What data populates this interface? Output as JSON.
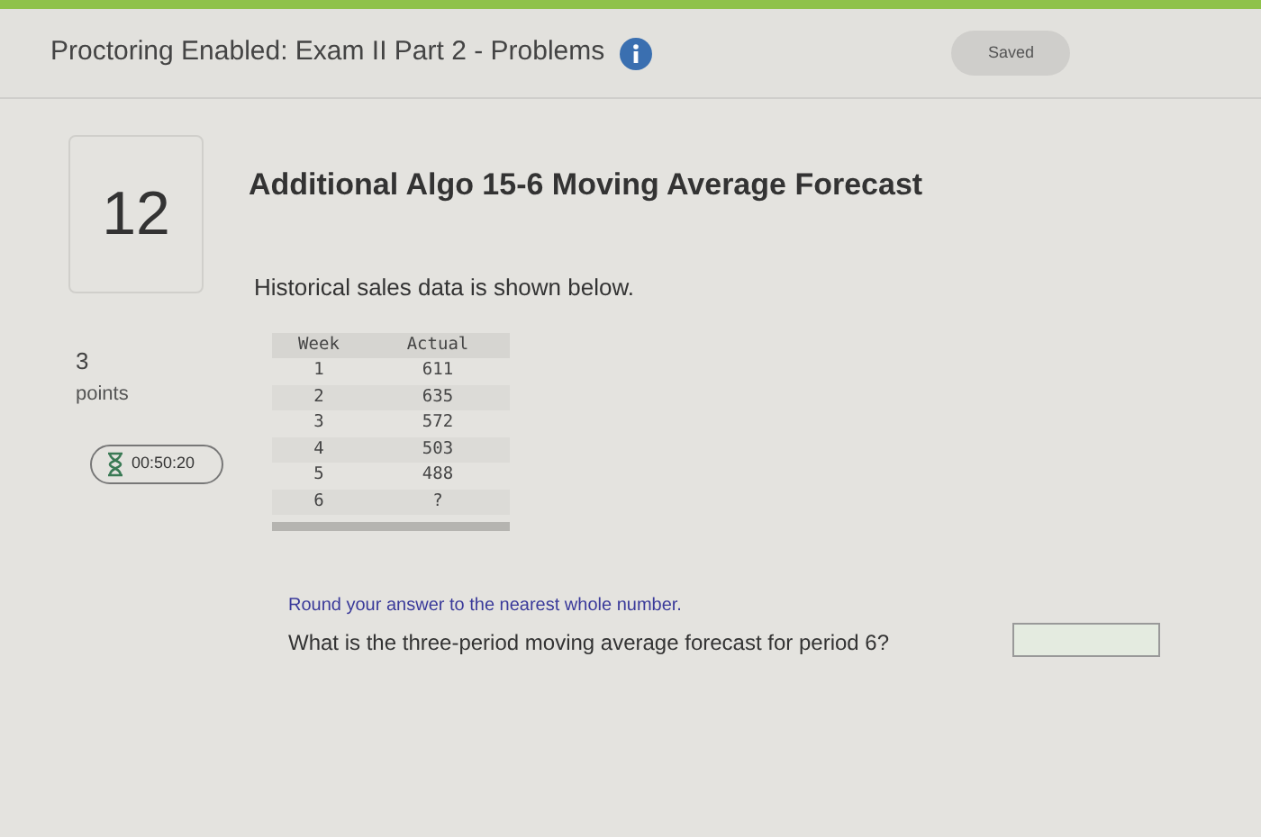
{
  "header": {
    "title": "Proctoring Enabled: Exam II Part 2 - Problems",
    "status": "Saved"
  },
  "question": {
    "number": "12",
    "points_value": "3",
    "points_label": "points",
    "timer": "00:50:20",
    "title": "Additional Algo 15-6 Moving Average Forecast",
    "intro": "Historical sales data is shown below.",
    "table": {
      "columns": [
        "Week",
        "Actual"
      ],
      "rows": [
        [
          "1",
          "611"
        ],
        [
          "2",
          "635"
        ],
        [
          "3",
          "572"
        ],
        [
          "4",
          "503"
        ],
        [
          "5",
          "488"
        ],
        [
          "6",
          "?"
        ]
      ]
    },
    "instruction": "Round your answer to the nearest whole number.",
    "prompt": "What is the three-period moving average forecast for period 6?"
  }
}
